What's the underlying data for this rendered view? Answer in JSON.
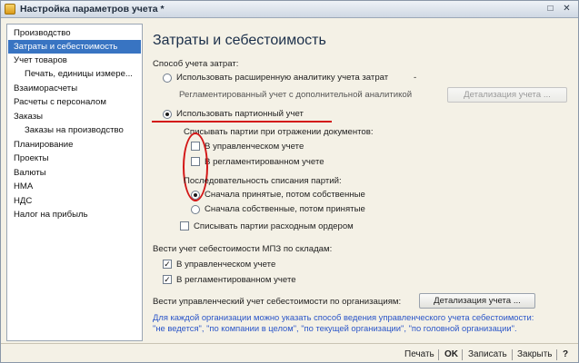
{
  "window": {
    "title": "Настройка параметров учета *",
    "icons": {
      "app": "window-icon",
      "maximize": "maximize-icon",
      "close": "close-icon"
    }
  },
  "sidebar": {
    "items": [
      {
        "label": "Производство",
        "active": false,
        "sub": false
      },
      {
        "label": "Затраты и себестоимость",
        "active": true,
        "sub": false
      },
      {
        "label": "Учет товаров",
        "active": false,
        "sub": false
      },
      {
        "label": "Печать, единицы измере...",
        "active": false,
        "sub": true
      },
      {
        "label": "Взаиморасчеты",
        "active": false,
        "sub": false
      },
      {
        "label": "Расчеты с персоналом",
        "active": false,
        "sub": false
      },
      {
        "label": "Заказы",
        "active": false,
        "sub": false
      },
      {
        "label": "Заказы на производство",
        "active": false,
        "sub": true
      },
      {
        "label": "Планирование",
        "active": false,
        "sub": false
      },
      {
        "label": "Проекты",
        "active": false,
        "sub": false
      },
      {
        "label": "Валюты",
        "active": false,
        "sub": false
      },
      {
        "label": "НМА",
        "active": false,
        "sub": false
      },
      {
        "label": "НДС",
        "active": false,
        "sub": false
      },
      {
        "label": "Налог на прибыль",
        "active": false,
        "sub": false
      }
    ]
  },
  "main": {
    "heading": "Затраты и себестоимость",
    "method": {
      "label": "Способ учета затрат:",
      "option_extended": "Использовать расширенную аналитику учета затрат",
      "dash": "-",
      "regulated_note": "Регламентированный учет с дополнительной аналитикой",
      "details_button_disabled": "Детализация учета ...",
      "option_batch": "Использовать партионный учет",
      "selected": "batch"
    },
    "writeoff": {
      "label": "Списывать партии при отражении документов:",
      "management": {
        "label": "В управленческом учете",
        "checked": false
      },
      "regulated": {
        "label": "В регламентированном учете",
        "checked": false
      }
    },
    "sequence": {
      "label": "Последовательность списания партий:",
      "option_accepted_first": "Сначала принятые, потом собственные",
      "option_own_first": "Сначала собственные, потом принятые",
      "selected": "accepted_first"
    },
    "expense_order": {
      "label": "Списывать партии расходным ордером",
      "checked": false
    },
    "warehouse": {
      "label": "Вести учет себестоимости МПЗ по складам:",
      "management": {
        "label": "В управленческом учете",
        "checked": true
      },
      "regulated": {
        "label": "В регламентированном учете",
        "checked": true
      }
    },
    "org": {
      "label": "Вести управленческий учет себестоимости по организациям:",
      "details_button": "Детализация учета ...",
      "hint_line1": "Для каждой организации можно указать способ ведения управленческого учета себестоимости:",
      "hint_line2": "\"не ведется\", \"по компании в целом\", \"по текущей организации\", \"по головной организации\"."
    },
    "check_mark": "✓"
  },
  "footer": {
    "print": "Печать",
    "ok": "OK",
    "save": "Записать",
    "close": "Закрыть",
    "help": "?"
  },
  "colors": {
    "accent": "#3874c2",
    "annotation": "#d31717",
    "hint": "#2a55c8"
  }
}
